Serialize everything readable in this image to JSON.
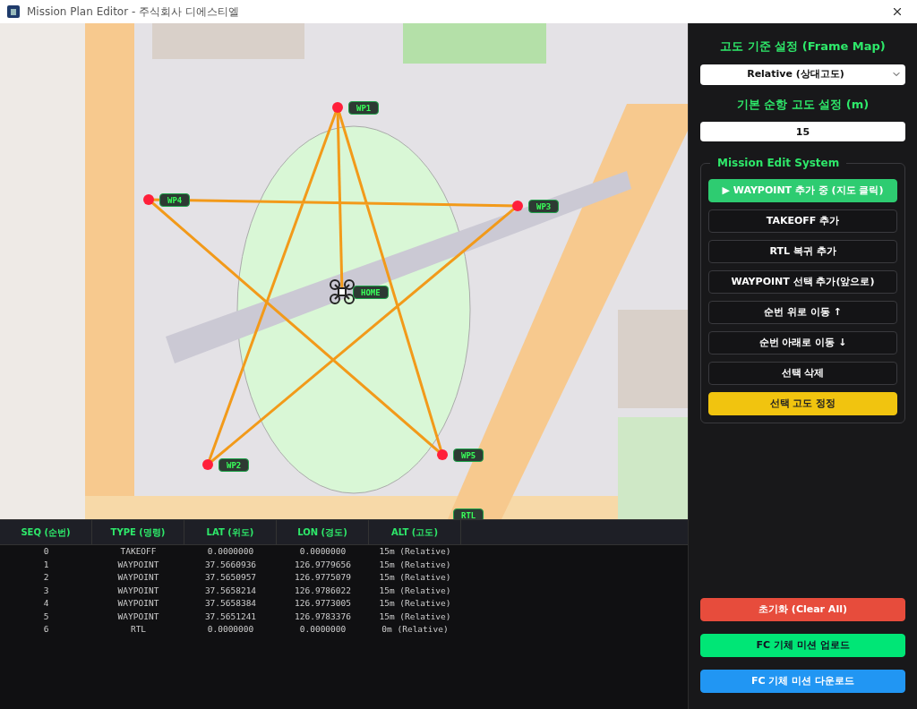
{
  "window": {
    "title": "Mission Plan Editor - 주식회사 디에스티엘"
  },
  "map": {
    "markers": [
      {
        "kind": "waypoint",
        "label": "WP1"
      },
      {
        "kind": "waypoint",
        "label": "WP4"
      },
      {
        "kind": "waypoint",
        "label": "WP3"
      },
      {
        "kind": "home",
        "label": "HOME"
      },
      {
        "kind": "waypoint",
        "label": "WP2"
      },
      {
        "kind": "waypoint",
        "label": "WP5"
      },
      {
        "kind": "rtl",
        "label": "RTL"
      }
    ]
  },
  "table": {
    "columns": [
      "SEQ (순번)",
      "TYPE (명령)",
      "LAT (위도)",
      "LON (경도)",
      "ALT (고도)"
    ],
    "rows": [
      [
        "0",
        "TAKEOFF",
        "0.0000000",
        "0.0000000",
        "15m (Relative)"
      ],
      [
        "1",
        "WAYPOINT",
        "37.5660936",
        "126.9779656",
        "15m (Relative)"
      ],
      [
        "2",
        "WAYPOINT",
        "37.5650957",
        "126.9775079",
        "15m (Relative)"
      ],
      [
        "3",
        "WAYPOINT",
        "37.5658214",
        "126.9786022",
        "15m (Relative)"
      ],
      [
        "4",
        "WAYPOINT",
        "37.5658384",
        "126.9773005",
        "15m (Relative)"
      ],
      [
        "5",
        "WAYPOINT",
        "37.5651241",
        "126.9783376",
        "15m (Relative)"
      ],
      [
        "6",
        "RTL",
        "0.0000000",
        "0.0000000",
        "0m (Relative)"
      ]
    ]
  },
  "panel": {
    "frame_heading": "고도 기준 설정 (Frame Map)",
    "frame_select": "Relative (상대고도)",
    "altitude_heading": "기본 순항 고도 설정 (m)",
    "altitude_value": "15",
    "group_title": "Mission Edit System",
    "buttons": [
      {
        "kind": "active",
        "label": "▶ WAYPOINT 추가 중 (지도 클릭)"
      },
      {
        "kind": "normal",
        "label": "TAKEOFF 추가"
      },
      {
        "kind": "normal",
        "label": "RTL 복귀 추가"
      },
      {
        "kind": "normal",
        "label": "WAYPOINT 선택 추가(앞으로)"
      },
      {
        "kind": "normal",
        "label": "순번 위로 이동 ↑"
      },
      {
        "kind": "normal",
        "label": "순번 아래로 이동 ↓"
      },
      {
        "kind": "normal",
        "label": "선택 삭제"
      },
      {
        "kind": "warning",
        "label": "선택 고도 정정"
      }
    ],
    "bottom_buttons": [
      {
        "kind": "danger",
        "label": "초기화 (Clear All)"
      },
      {
        "kind": "upload",
        "label": "FC 기체 미션 업로드"
      },
      {
        "kind": "download",
        "label": "FC 기체 미션 다운로드"
      }
    ]
  }
}
